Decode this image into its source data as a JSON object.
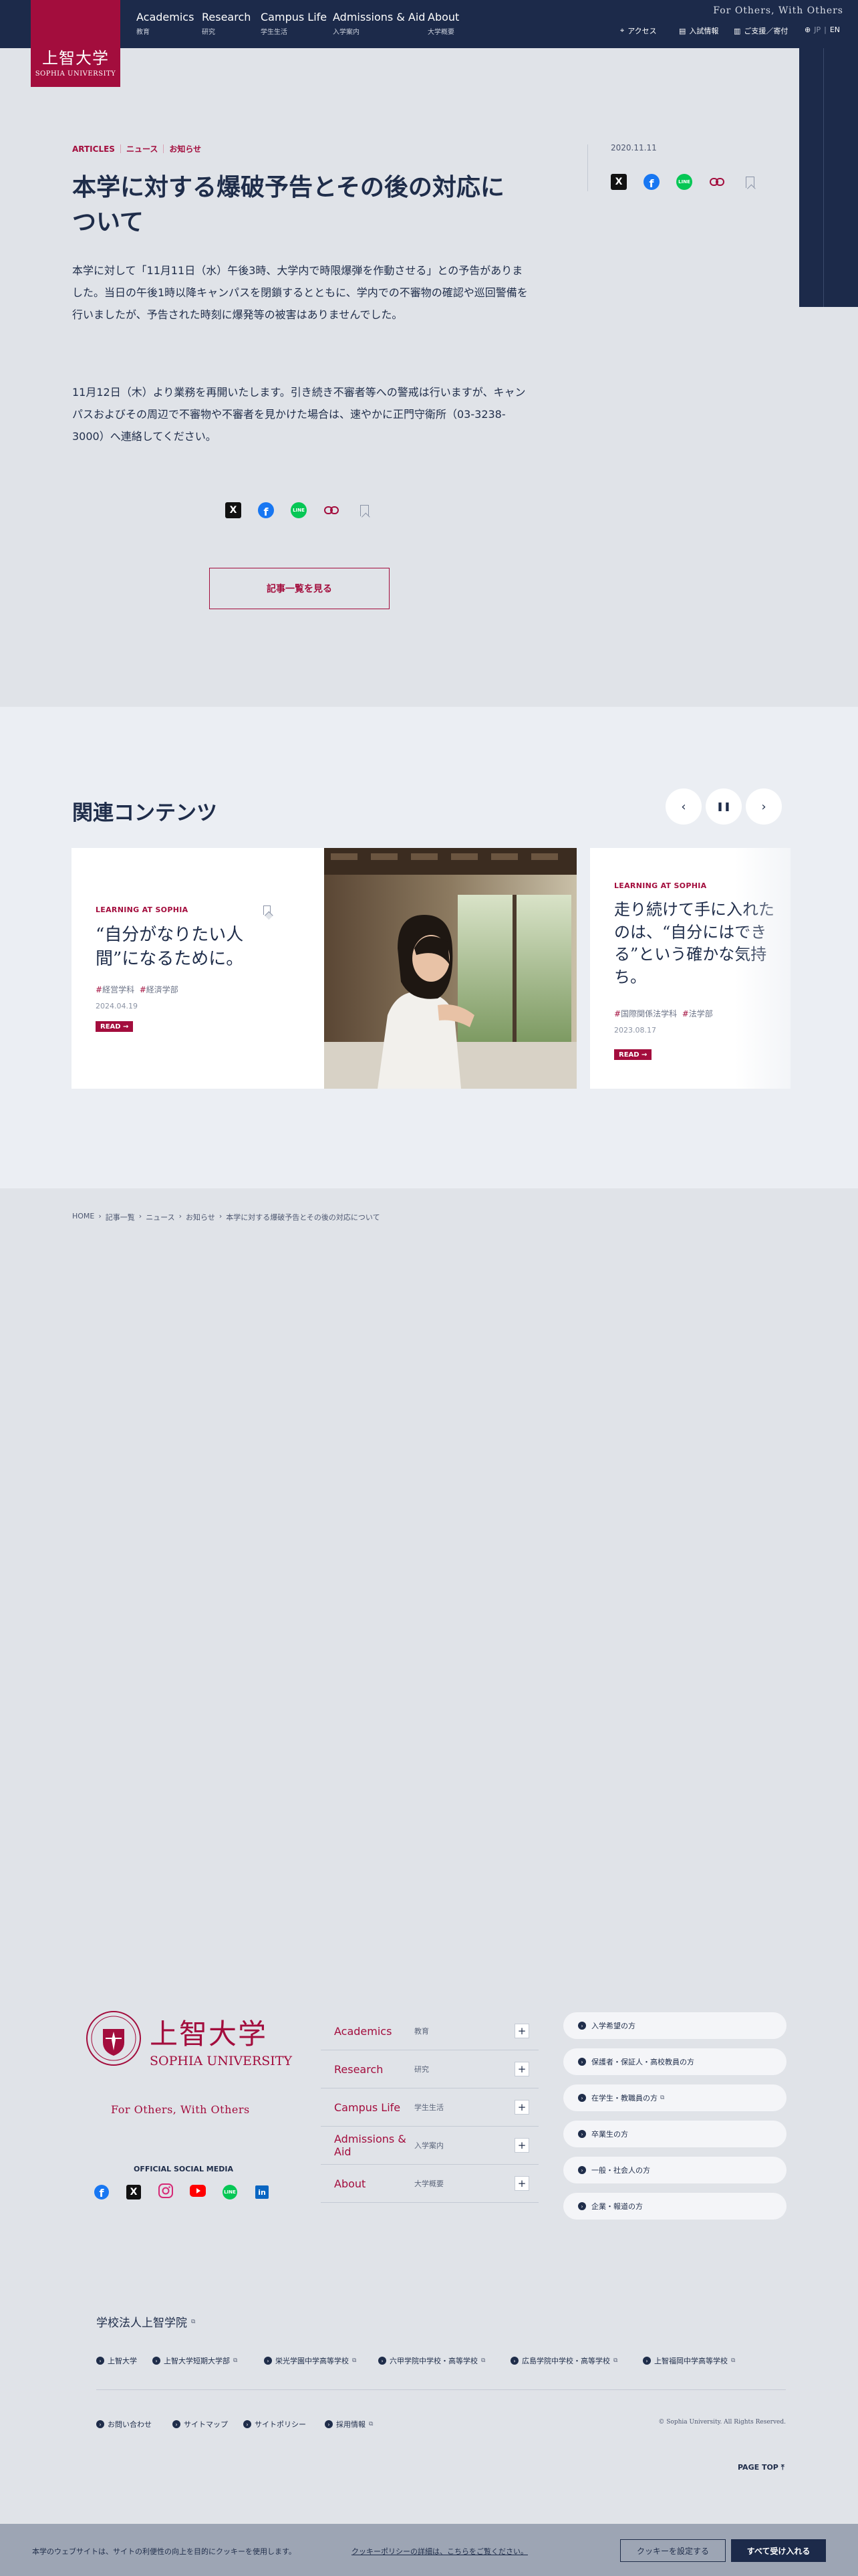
{
  "header": {
    "logo_ja": "上智大学",
    "logo_en": "SOPHIA UNIVERSITY",
    "tagline": "For Others, With Others",
    "nav": [
      {
        "en": "Academics",
        "ja": "教育"
      },
      {
        "en": "Research",
        "ja": "研究"
      },
      {
        "en": "Campus Life",
        "ja": "学生生活"
      },
      {
        "en": "Admissions & Aid",
        "ja": "入学案内"
      },
      {
        "en": "About",
        "ja": "大学概要"
      }
    ],
    "utility": {
      "access": "アクセス",
      "exam": "入試情報",
      "support": "ご支援／寄付",
      "lang_ja": "JP",
      "lang_en": "EN"
    }
  },
  "article": {
    "categories": [
      "ARTICLES",
      "ニュース",
      "お知らせ"
    ],
    "date": "2020.11.11",
    "title": "本学に対する爆破予告とその後の対応について",
    "paragraph1": "本学に対して「11月11日（水）午後3時、大学内で時限爆弾を作動させる」との予告がありました。当日の午後1時以降キャンパスを閉鎖するとともに、学内での不審物の確認や巡回警備を行いましたが、予告された時刻に爆発等の被害はありませんでした。",
    "paragraph2": "11月12日（木）より業務を再開いたします。引き続き不審者等への警戒は行いますが、キャンパスおよびその周辺で不審物や不審者を見かけた場合は、速やかに正門守衛所（03-3238-3000）へ連絡してください。",
    "list_button": "記事一覧を見る"
  },
  "share": {
    "x": "X",
    "facebook": "f",
    "line": "LINE"
  },
  "related": {
    "title": "関連コンテンツ",
    "cards": [
      {
        "label": "LEARNING AT SOPHIA",
        "title": "“自分がなりたい人間”になるために。",
        "tags": [
          "経営学科",
          "経済学部"
        ],
        "date": "2024.04.19",
        "read": "READ →"
      },
      {
        "label": "LEARNING AT SOPHIA",
        "title": "走り続けて手に入れたのは、“自分にはできる”という確かな気持ち。",
        "tags": [
          "国際関係法学科",
          "法学部"
        ],
        "date": "2023.08.17",
        "read": "READ →"
      }
    ]
  },
  "breadcrumb": [
    "HOME",
    "記事一覧",
    "ニュース",
    "お知らせ",
    "本学に対する爆破予告とその後の対応について"
  ],
  "footer": {
    "logo_ja": "上智大学",
    "logo_en": "SOPHIA UNIVERSITY",
    "tagline": "For Others, With Others",
    "social_heading": "OFFICIAL SOCIAL MEDIA",
    "nav": [
      {
        "en": "Academics",
        "ja": "教育"
      },
      {
        "en": "Research",
        "ja": "研究"
      },
      {
        "en": "Campus Life",
        "ja": "学生生活"
      },
      {
        "en": "Admissions & Aid",
        "ja": "入学案内"
      },
      {
        "en": "About",
        "ja": "大学概要"
      }
    ],
    "audience": [
      "入学希望の方",
      "保護者・保証人・高校教員の方",
      "在学生・教職員の方",
      "卒業生の方",
      "一般・社会人の方",
      "企業・報道の方"
    ],
    "group_title": "学校法人上智学院",
    "group_links": [
      "上智大学",
      "上智大学短期大学部",
      "栄光学園中学高等学校",
      "六甲学院中学校・高等学校",
      "広島学院中学校・高等学校",
      "上智福岡中学高等学校"
    ],
    "bottom_links": [
      "お問い合わせ",
      "サイトマップ",
      "サイトポリシー",
      "採用情報"
    ],
    "copyright": "© Sophia University. All Rights Reserved.",
    "page_top": "PAGE TOP"
  },
  "cookie": {
    "text": "本学のウェブサイトは、サイトの利便性の向上を目的にクッキーを使用します。",
    "link": "クッキーポリシーの詳細は、こちらをご覧ください。",
    "settings": "クッキーを設定する",
    "accept": "すべて受け入れる"
  }
}
